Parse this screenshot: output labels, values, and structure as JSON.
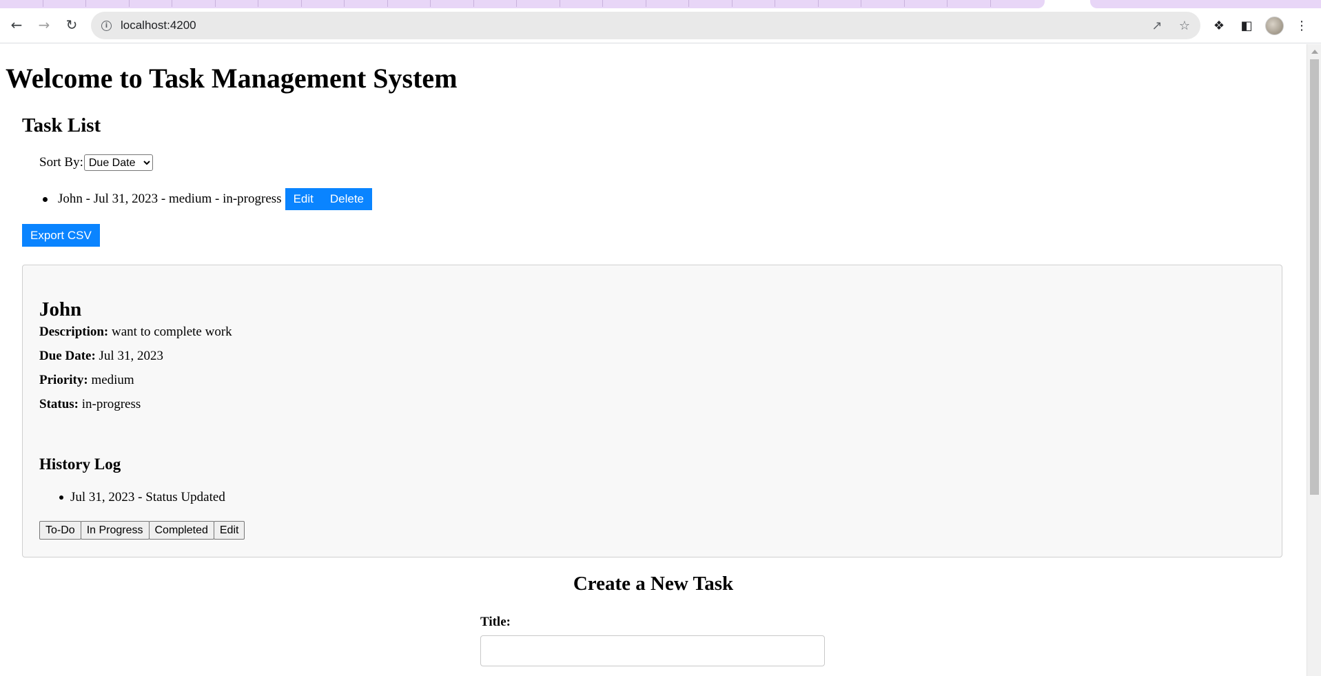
{
  "browser": {
    "url": "localhost:4200"
  },
  "page": {
    "title": "Welcome to Task Management System",
    "task_list_heading": "Task List",
    "sort_label": "Sort By:",
    "sort_selected": "Due Date",
    "tasks": [
      {
        "summary": "John - Jul 31, 2023 - medium - in-progress",
        "edit_label": "Edit",
        "delete_label": "Delete"
      }
    ],
    "export_label": "Export CSV"
  },
  "details": {
    "name": "John",
    "description_label": "Description:",
    "description": "want to complete work",
    "due_date_label": "Due Date:",
    "due_date": "Jul 31, 2023",
    "priority_label": "Priority:",
    "priority": "medium",
    "status_label": "Status:",
    "status": "in-progress",
    "history_heading": "History Log",
    "history": [
      "Jul 31, 2023 - Status Updated"
    ],
    "buttons": {
      "todo": "To-Do",
      "in_progress": "In Progress",
      "completed": "Completed",
      "edit": "Edit"
    }
  },
  "create": {
    "heading": "Create a New Task",
    "title_label": "Title:"
  },
  "colors": {
    "accent": "#0a84ff",
    "tab_strip": "#e8d6f7"
  }
}
